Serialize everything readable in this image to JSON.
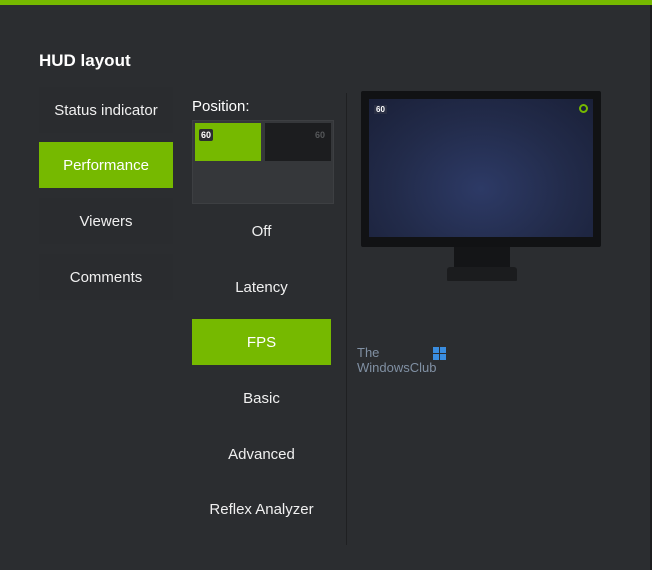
{
  "hud": {
    "title": "HUD layout",
    "categories": [
      {
        "label": "Status indicator",
        "active": false
      },
      {
        "label": "Performance",
        "active": true
      },
      {
        "label": "Viewers",
        "active": false
      },
      {
        "label": "Comments",
        "active": false
      }
    ],
    "position": {
      "label": "Position:",
      "cells": [
        {
          "value": "60",
          "selected": true
        },
        {
          "value": "60",
          "selected": false
        }
      ]
    },
    "options": [
      {
        "label": "Off",
        "active": false
      },
      {
        "label": "Latency",
        "active": false
      },
      {
        "label": "FPS",
        "active": true
      },
      {
        "label": "Basic",
        "active": false
      },
      {
        "label": "Advanced",
        "active": false
      },
      {
        "label": "Reflex Analyzer",
        "active": false
      }
    ],
    "preview": {
      "fps_value": "60",
      "indicator_icon": "status-indicator-icon"
    }
  },
  "watermark": {
    "line1": "The",
    "line2": "WindowsClub"
  },
  "colors": {
    "accent": "#76b900",
    "background": "#2b2d30"
  }
}
